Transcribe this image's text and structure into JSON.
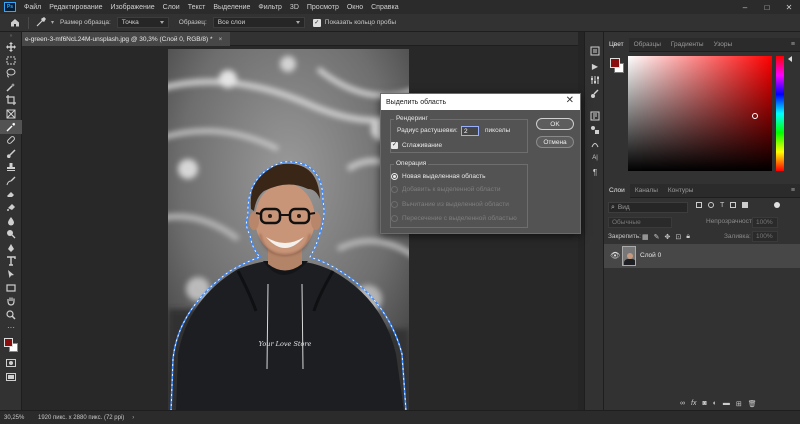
{
  "app": {
    "logo_text": "Ps"
  },
  "menu": [
    "Файл",
    "Редактирование",
    "Изображение",
    "Слои",
    "Текст",
    "Выделение",
    "Фильтр",
    "3D",
    "Просмотр",
    "Окно",
    "Справка"
  ],
  "options": {
    "sample_size_label": "Размер образца:",
    "sample_size_value": "Точка",
    "sample_label": "Образец:",
    "sample_value": "Все слои",
    "ring_label": "Показать кольцо пробы"
  },
  "document": {
    "tab_title": "e-green-3-mf6NcL24M-unsplash.jpg @ 30,3% (Слой 0, RGB/8) *",
    "close": "×"
  },
  "status": {
    "zoom": "30,25%",
    "info": "1920 пикс. x 2880 пикс. (72 ppi)",
    "arrow": "›"
  },
  "color_panel": {
    "tabs": [
      "Цвет",
      "Образцы",
      "Градиенты",
      "Узоры"
    ],
    "fg": "#8b0e0e",
    "bg": "#ffffff",
    "hue": "#ff0000"
  },
  "layers_panel": {
    "tabs": [
      "Слои",
      "Каналы",
      "Контуры"
    ],
    "search_placeholder": "Вид",
    "blend_mode": "Обычные",
    "opacity_label": "Непрозрачность:",
    "opacity_value": "100%",
    "lock_label": "Закрепить:",
    "fill_label": "Заливка:",
    "fill_value": "100%",
    "layer_name": "Слой 0"
  },
  "dialog": {
    "title": "Выделить область",
    "rendering_group": "Рендеринг",
    "feather_label": "Радиус растушевки:",
    "feather_value": "2",
    "feather_unit": "пикселы",
    "antialias_label": "Сглаживание",
    "operation_group": "Операция",
    "op_new": "Новая выделенная область",
    "op_add": "Добавить к выделенной области",
    "op_subtract": "Вычитание из выделенной области",
    "op_intersect": "Пересечение с выделенной областью",
    "ok_label": "OK",
    "cancel_label": "Отмена"
  },
  "photo": {
    "shirt_text": "Your Love Store"
  }
}
